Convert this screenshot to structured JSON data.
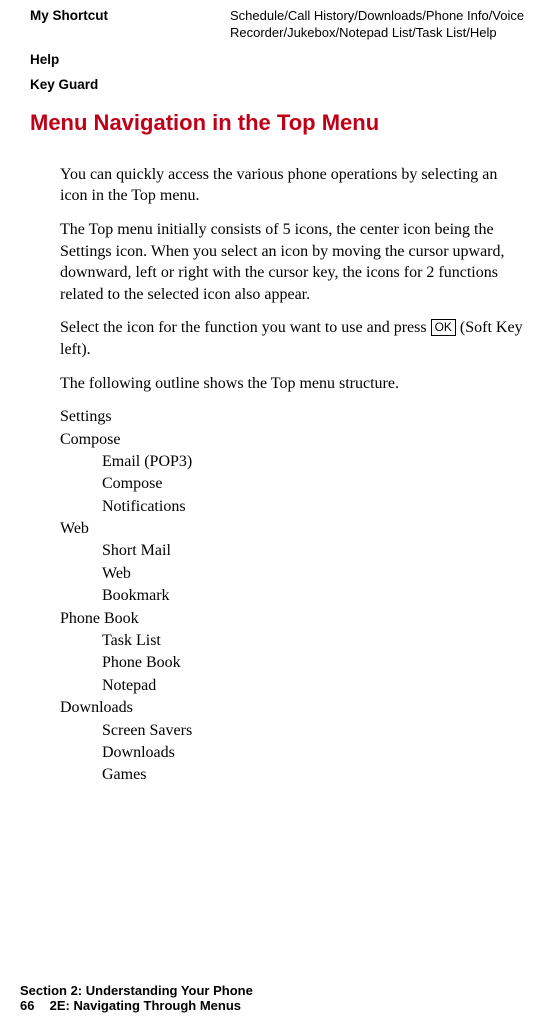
{
  "table": {
    "my_shortcut_label": "My Shortcut",
    "my_shortcut_value": "Schedule/Call History/Downloads/Phone Info/Voice Recorder/Jukebox/Notepad List/Task List/Help",
    "help_label": "Help",
    "key_guard_label": "Key Guard"
  },
  "heading": "Menu Navigation in the Top Menu",
  "para1": "You can quickly access the various phone operations by selecting an icon in the Top menu.",
  "para2": "The Top menu initially consists of 5 icons, the center icon being the Settings icon. When you select an icon by moving the cursor upward, downward, left or right with the cursor key, the icons for 2 functions related to the selected icon also appear.",
  "para3_a": "Select the icon for the function you want to use and press ",
  "ok_label": "OK",
  "para3_b": " (Soft Key left).",
  "para4": "The following outline shows the Top menu structure.",
  "outline": {
    "settings": "Settings",
    "compose": {
      "label": "Compose",
      "items": [
        "Email (POP3)",
        "Compose",
        "Notifications"
      ]
    },
    "web": {
      "label": "Web",
      "items": [
        "Short Mail",
        "Web",
        "Bookmark"
      ]
    },
    "phonebook": {
      "label": "Phone Book",
      "items": [
        "Task List",
        "Phone Book",
        "Notepad"
      ]
    },
    "downloads": {
      "label": "Downloads",
      "items": [
        "Screen Savers",
        "Downloads",
        "Games"
      ]
    }
  },
  "footer": {
    "section_line": "Section 2: Understanding Your Phone",
    "page_number": "66",
    "chapter": "2E: Navigating Through Menus"
  }
}
